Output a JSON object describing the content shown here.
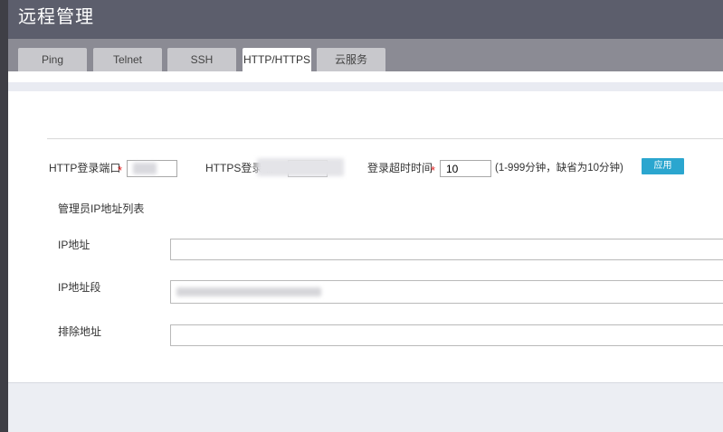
{
  "header": {
    "title": "远程管理"
  },
  "tabs": [
    {
      "label": "Ping"
    },
    {
      "label": "Telnet"
    },
    {
      "label": "SSH"
    },
    {
      "label": "HTTP/HTTPS",
      "active": true
    },
    {
      "label": "云服务"
    }
  ],
  "form": {
    "http_port": {
      "label": "HTTP登录端口",
      "required_mark": "*",
      "value": ""
    },
    "https_port": {
      "label": "HTTPS登录端",
      "value": ""
    },
    "timeout": {
      "label": "登录超时时间",
      "required_mark": "*",
      "value": "10",
      "hint": "(1-999分钟，缺省为10分钟)"
    },
    "apply_label": "应用",
    "ip_list_title": "管理员IP地址列表",
    "ip_address": {
      "label": "IP地址",
      "value": ""
    },
    "ip_range": {
      "label": "IP地址段",
      "value": ""
    },
    "exclude_address": {
      "label": "排除地址",
      "value": ""
    }
  },
  "colors": {
    "header_bg": "#5c5e6c",
    "tabbar_bg": "#8b8b94",
    "tab_bg": "#c8c8cc",
    "tab_active_bg": "#ffffff",
    "apply_button": "#2ba6cf",
    "required": "#e02020"
  }
}
